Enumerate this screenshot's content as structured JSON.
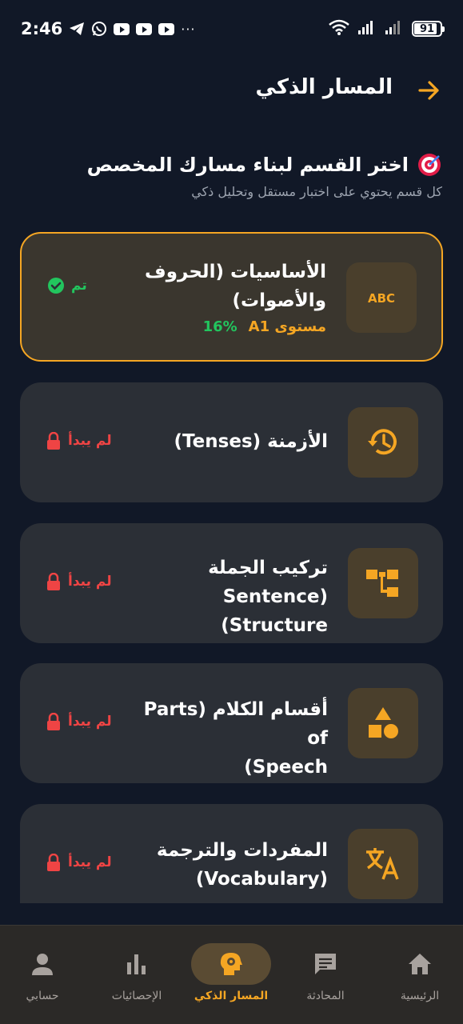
{
  "status_bar": {
    "time": "2:46",
    "battery": "91",
    "overflow": "···"
  },
  "header": {
    "title": "المسار الذكي",
    "back_icon": "arrow-right-icon"
  },
  "intro": {
    "title": "اختر القسم لبناء مسارك المخصص",
    "subtitle": "كل قسم يحتوي على اختبار مستقل وتحليل ذكي",
    "icon": "target-icon"
  },
  "sections": [
    {
      "title_line1": "الأساسيات (الحروف",
      "title_line2": "والأصوات)",
      "level": "مستوى A1",
      "progress": "16%",
      "status": "تم",
      "icon": "abc-icon",
      "state": "done"
    },
    {
      "title_line1": "الأزمنة (Tenses)",
      "status": "لم يبدأ",
      "icon": "history-icon",
      "state": "locked"
    },
    {
      "title_line1": "تركيب الجملة",
      "title_line2": "(Sentence Structure)",
      "status": "لم يبدأ",
      "icon": "tree-structure-icon",
      "state": "locked"
    },
    {
      "title_line1": "أقسام الكلام (Parts of",
      "title_line2": "Speech)",
      "status": "لم يبدأ",
      "icon": "shapes-icon",
      "state": "locked"
    },
    {
      "title_line1": "المفردات والترجمة",
      "title_line2": "(Vocabulary)",
      "status": "لم يبدأ",
      "icon": "translate-icon",
      "state": "locked"
    }
  ],
  "bottom_nav": [
    {
      "label": "الرئيسية",
      "icon": "home-icon"
    },
    {
      "label": "المحادثة",
      "icon": "chat-icon"
    },
    {
      "label": "المسار الذكي",
      "icon": "smart-path-icon",
      "active": true
    },
    {
      "label": "الإحصائيات",
      "icon": "bar-chart-icon"
    },
    {
      "label": "حسابي",
      "icon": "person-icon"
    }
  ],
  "colors": {
    "background": "#111827",
    "card": "#2b2f36",
    "accent": "#f5a623",
    "success": "#22c55e",
    "danger": "#ef4444"
  }
}
